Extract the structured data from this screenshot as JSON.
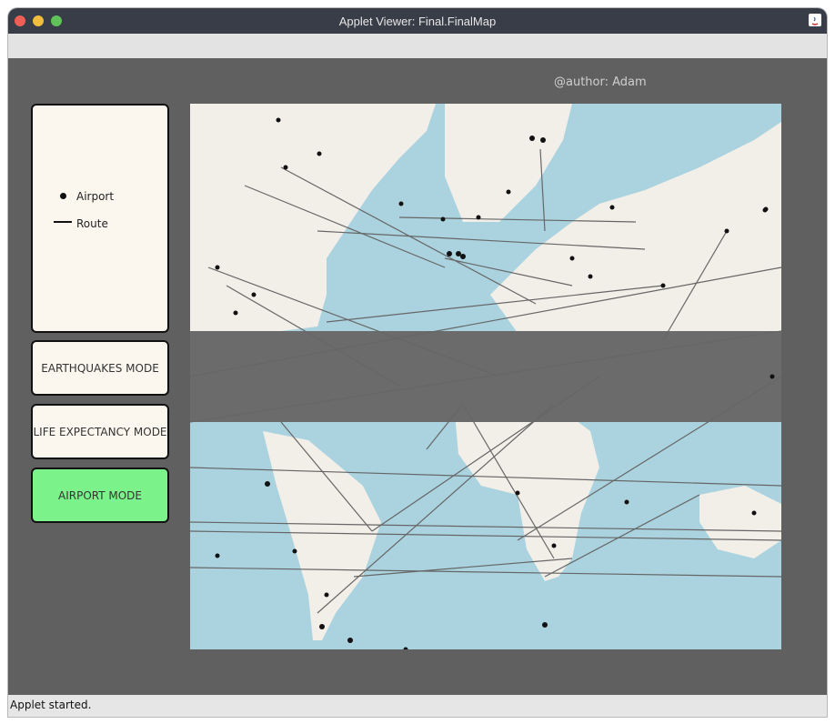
{
  "window": {
    "title": "Applet Viewer: Final.FinalMap"
  },
  "canvas": {
    "author": "@author: Adam"
  },
  "legend": {
    "airport_label": "Airport",
    "route_label": "Route"
  },
  "modes": {
    "earthquakes": "EARTHQUAKES MODE",
    "life_expectancy": "LIFE EXPECTANCY MODE",
    "airport": "AIRPORT MODE",
    "active": "airport"
  },
  "status": {
    "text": "Applet started."
  },
  "colors": {
    "ocean": "#aad3df",
    "land": "#f2efe9",
    "route": "#666666",
    "airport": "#111111",
    "active_button": "#7bf38a",
    "button": "#fbf7ef",
    "canvas_bg": "#606060"
  }
}
